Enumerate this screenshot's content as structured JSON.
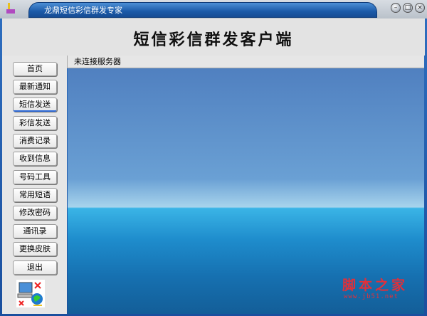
{
  "window": {
    "title": "龙鼎短信彩信群发专家",
    "minimize": "–",
    "maximize": "□",
    "close": "×"
  },
  "header": {
    "title": "短信彩信群发客户端"
  },
  "status": {
    "text": "未连接服务器"
  },
  "sidebar": {
    "items": [
      {
        "label": "首页"
      },
      {
        "label": "最新通知"
      },
      {
        "label": "短信发送"
      },
      {
        "label": "彩信发送"
      },
      {
        "label": "消费记录"
      },
      {
        "label": "收到信息"
      },
      {
        "label": "号码工具"
      },
      {
        "label": "常用短语"
      },
      {
        "label": "修改密码"
      },
      {
        "label": "通讯录"
      },
      {
        "label": "更换皮肤"
      },
      {
        "label": "退出"
      }
    ],
    "active_index": 2
  },
  "watermark": {
    "name": "脚本之家",
    "url": "www.jb51.net"
  }
}
